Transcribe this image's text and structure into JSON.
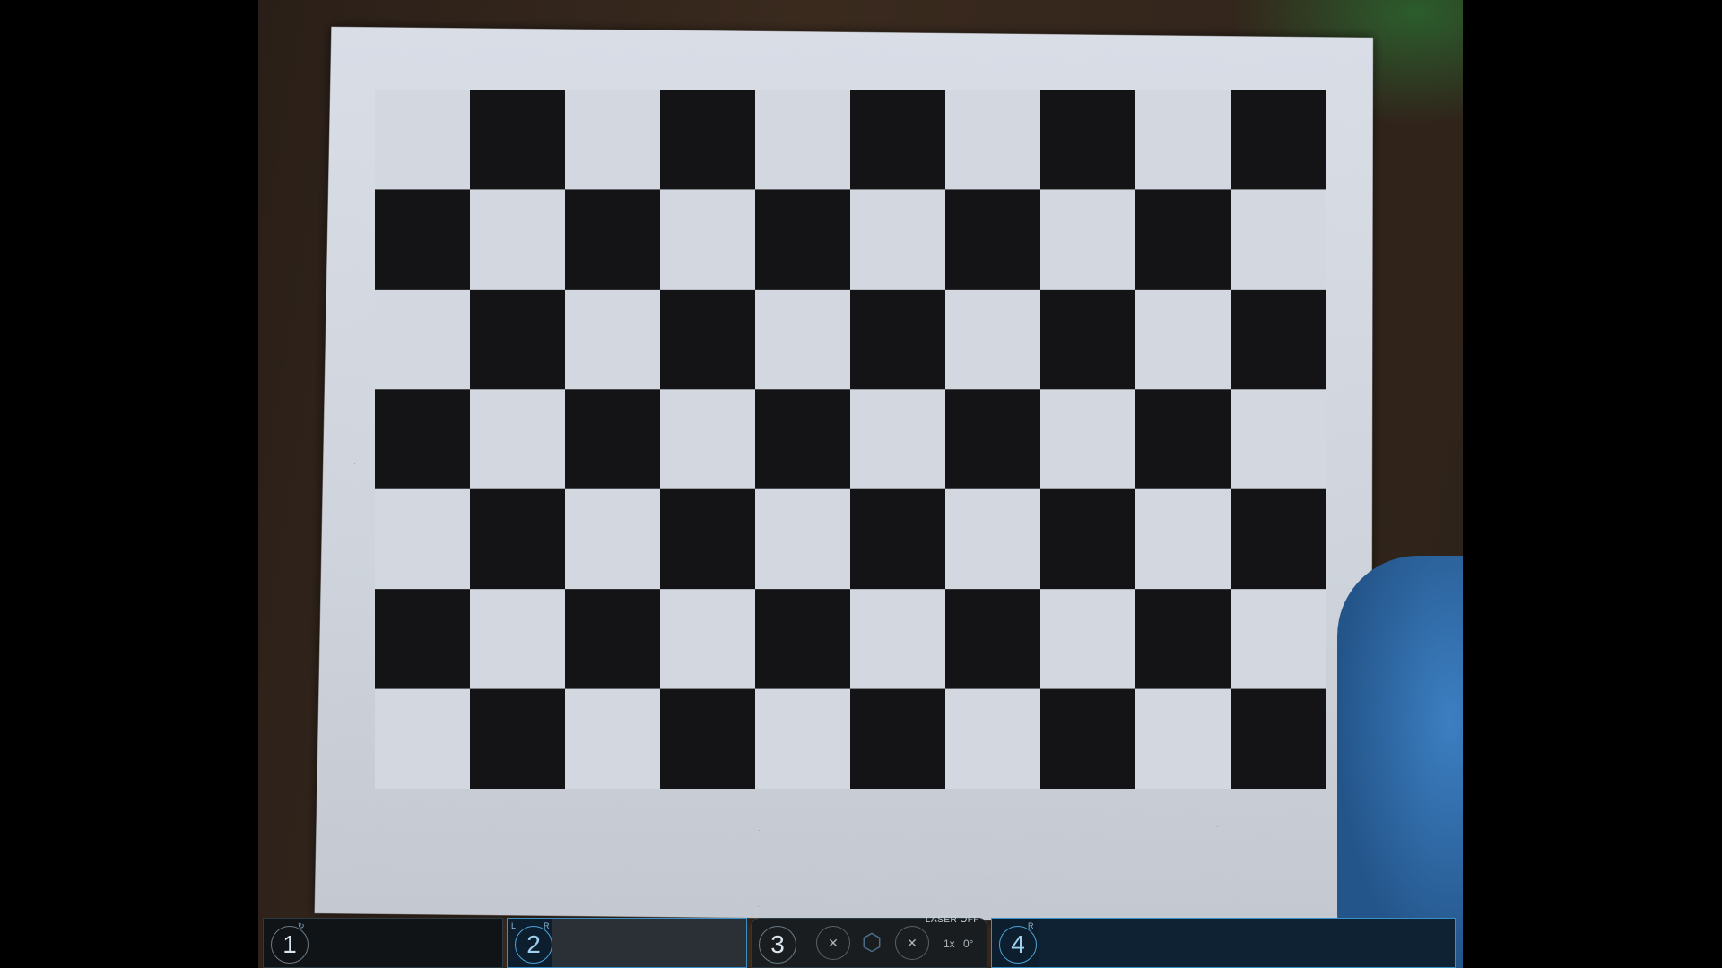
{
  "camera_view": {
    "description_label": "",
    "checkerboard": {
      "rows": 7,
      "cols": 10
    }
  },
  "hud": {
    "panels": [
      {
        "number": "1",
        "tag_right": "↻",
        "tag_left": "",
        "state": "normal"
      },
      {
        "number": "2",
        "tag_left": "L",
        "tag_right": "R",
        "state": "active"
      },
      {
        "number": "3",
        "tag_left": "",
        "tag_right": "",
        "state": "normal"
      },
      {
        "number": "4",
        "tag_left": "",
        "tag_right": "R",
        "state": "active"
      }
    ],
    "laser_label": "LASER OFF",
    "zoom_label": "1x",
    "angle_label": "0°",
    "tools": [
      {
        "icon": "crosshair-icon",
        "glyph": "✕"
      },
      {
        "icon": "hexagon-icon",
        "glyph": "⬡"
      },
      {
        "icon": "target-icon",
        "glyph": "✕"
      }
    ]
  },
  "colors": {
    "accent": "#3a8fc4",
    "panel_bg": "#111417",
    "dark_square": "#141416",
    "light_square": "#d3d7df"
  }
}
